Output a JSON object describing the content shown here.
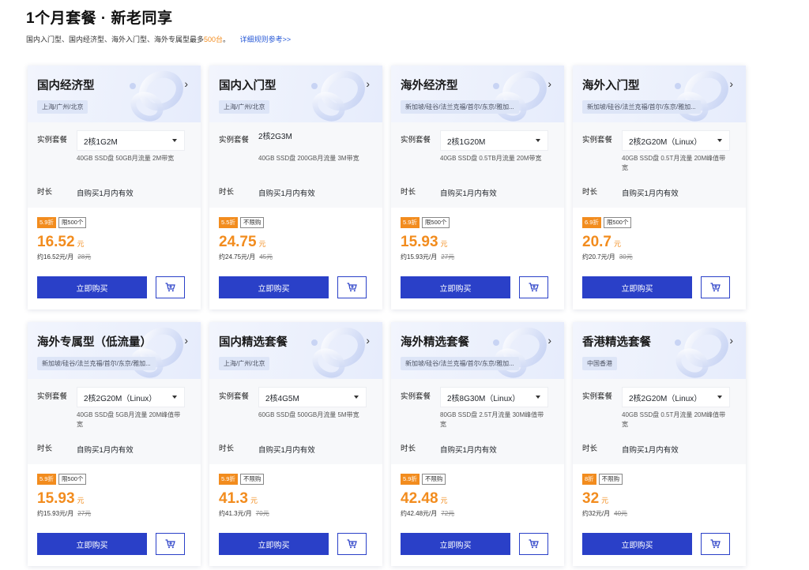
{
  "header": {
    "title": "1个月套餐 · 新老同享",
    "subtitle_prefix": "国内入门型、国内经济型、海外入门型、海外专属型最多",
    "subtitle_highlight": "500台",
    "subtitle_suffix": "。",
    "rules_link": "详细规则参考>>"
  },
  "labels": {
    "instance": "实例套餐",
    "duration": "时长",
    "buy": "立即购买",
    "yuan": "元"
  },
  "colors": {
    "accent": "#f28c1e",
    "primary": "#2a40c8",
    "link": "#2a5bd7"
  },
  "cards": [
    {
      "title": "国内经济型",
      "region": "上海/广州/北京",
      "has_select": true,
      "instance": "2核1G2M",
      "spec": "40GB SSD盘 50GB月流量 2M带宽",
      "duration": "自购买1月内有效",
      "discount": "5.9折",
      "limit": "限500个",
      "price": "16.52",
      "per_month": "约16.52元/月",
      "orig": "28元"
    },
    {
      "title": "国内入门型",
      "region": "上海/广州/北京",
      "has_select": false,
      "instance": "2核2G3M",
      "spec": "40GB SSD盘 200GB月流量 3M带宽",
      "duration": "自购买1月内有效",
      "discount": "5.5折",
      "limit": "不限购",
      "price": "24.75",
      "per_month": "约24.75元/月",
      "orig": "45元"
    },
    {
      "title": "海外经济型",
      "region": "新加坡/硅谷/法兰克福/首尔/东京/雅加...",
      "has_select": true,
      "instance": "2核1G20M",
      "spec": "40GB SSD盘 0.5TB月流量 20M带宽",
      "duration": "自购买1月内有效",
      "discount": "5.9折",
      "limit": "限500个",
      "price": "15.93",
      "per_month": "约15.93元/月",
      "orig": "27元"
    },
    {
      "title": "海外入门型",
      "region": "新加坡/硅谷/法兰克福/首尔/东京/雅加...",
      "has_select": true,
      "instance": "2核2G20M（Linux）",
      "spec": "40GB SSD盘 0.5T月流量 20M峰值带宽",
      "duration": "自购买1月内有效",
      "discount": "6.9折",
      "limit": "限500个",
      "price": "20.7",
      "per_month": "约20.7元/月",
      "orig": "30元"
    },
    {
      "title": "海外专属型（低流量）",
      "region": "新加坡/硅谷/法兰克福/首尔/东京/雅加...",
      "has_select": true,
      "instance": "2核2G20M（Linux）",
      "spec": "40GB SSD盘 5GB月流量 20M峰值带宽",
      "duration": "自购买1月内有效",
      "discount": "5.9折",
      "limit": "限500个",
      "price": "15.93",
      "per_month": "约15.93元/月",
      "orig": "27元"
    },
    {
      "title": "国内精选套餐",
      "region": "上海/广州/北京",
      "has_select": true,
      "instance": "2核4G5M",
      "spec": "60GB SSD盘 500GB月流量 5M带宽",
      "duration": "自购买1月内有效",
      "discount": "5.9折",
      "limit": "不限购",
      "price": "41.3",
      "per_month": "约41.3元/月",
      "orig": "70元"
    },
    {
      "title": "海外精选套餐",
      "region": "新加坡/硅谷/法兰克福/首尔/东京/雅加...",
      "has_select": true,
      "instance": "2核8G30M（Linux）",
      "spec": "80GB SSD盘 2.5T月流量 30M峰值带宽",
      "duration": "自购买1月内有效",
      "discount": "5.9折",
      "limit": "不限购",
      "price": "42.48",
      "per_month": "约42.48元/月",
      "orig": "72元"
    },
    {
      "title": "香港精选套餐",
      "region": "中国香港",
      "has_select": true,
      "instance": "2核2G20M（Linux）",
      "spec": "40GB SSD盘 0.5T月流量 20M峰值带宽",
      "duration": "自购买1月内有效",
      "discount": "8折",
      "limit": "不限购",
      "price": "32",
      "per_month": "约32元/月",
      "orig": "40元"
    }
  ]
}
